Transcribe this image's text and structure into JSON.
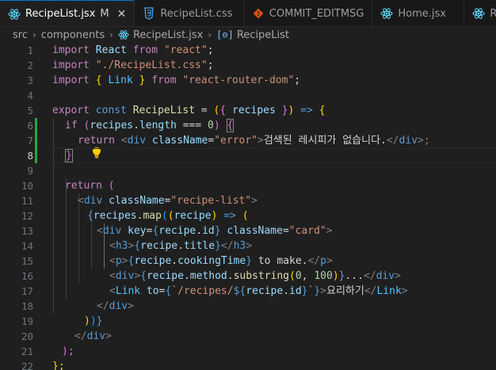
{
  "tabs": [
    {
      "label": "RecipeList.jsx",
      "modified": "M",
      "icon": "react-icon",
      "active": true
    },
    {
      "label": "RecipeList.css",
      "icon": "css-icon",
      "active": false
    },
    {
      "label": "COMMIT_EDITMSG",
      "icon": "git-icon",
      "active": false
    },
    {
      "label": "Home.jsx",
      "icon": "react-icon",
      "active": false
    },
    {
      "label": "Re",
      "icon": "react-icon",
      "active": false
    }
  ],
  "breadcrumb": {
    "parts": [
      "src",
      "components",
      "RecipeList.jsx",
      "RecipeList"
    ]
  },
  "line_numbers": [
    "1",
    "2",
    "3",
    "4",
    "5",
    "6",
    "7",
    "8",
    "9",
    "10",
    "11",
    "12",
    "13",
    "14",
    "15",
    "16",
    "17",
    "18",
    "19",
    "20",
    "21",
    "22"
  ],
  "code": {
    "l1": [
      "import",
      " React ",
      "from",
      " \"react\"",
      ";"
    ],
    "l2": [
      "import",
      " \"./RecipeList.css\"",
      ";"
    ],
    "l3": [
      "import",
      " { ",
      "Link",
      " } ",
      "from",
      " \"react-router-dom\"",
      ";"
    ],
    "l5": [
      "export",
      " const ",
      "RecipeList",
      " = ",
      "(",
      "{ ",
      "recipes",
      " }",
      ")",
      " => ",
      "{"
    ],
    "l6": [
      "if",
      " (",
      "recipes",
      ".",
      "length",
      " === ",
      "0",
      ") ",
      "{"
    ],
    "l7": [
      "return",
      " <",
      "div",
      " className",
      "=",
      "\"error\"",
      ">",
      "검색된 레시피가 없습니다.",
      "</",
      "div",
      ">;"
    ],
    "l8": [
      "}"
    ],
    "l10": [
      "return",
      " ("
    ],
    "l11": [
      "<",
      "div",
      " className",
      "=",
      "\"recipe-list\"",
      ">"
    ],
    "l12": [
      "{",
      "recipes",
      ".",
      "map",
      "(",
      "(",
      "recipe",
      ")",
      " => ",
      "("
    ],
    "l13": [
      "<",
      "div",
      " key",
      "=",
      "{",
      "recipe",
      ".",
      "id",
      "}",
      " className",
      "=",
      "\"card\"",
      ">"
    ],
    "l14": [
      "<",
      "h3",
      ">",
      "{",
      "recipe",
      ".",
      "title",
      "}",
      "</",
      "h3",
      ">"
    ],
    "l15": [
      "<",
      "p",
      ">",
      "{",
      "recipe",
      ".",
      "cookingTime",
      "}",
      " to make.",
      "</",
      "p",
      ">"
    ],
    "l16": [
      "<",
      "div",
      ">",
      "{",
      "recipe",
      ".",
      "method",
      ".",
      "substring",
      "(",
      "0",
      ", ",
      "100",
      ")",
      "}",
      "...",
      "</",
      "div",
      ">"
    ],
    "l17": [
      "<",
      "Link",
      " to",
      "=",
      "{",
      "`/recipes/",
      "${",
      "recipe",
      ".",
      "id",
      "}",
      "`",
      "}",
      ">",
      "요리하기",
      "</",
      "Link",
      ">"
    ],
    "l18": [
      "</",
      "div",
      ">"
    ],
    "l19": [
      ")",
      ")",
      "}"
    ],
    "l20": [
      "</",
      "div",
      ">"
    ],
    "l21": [
      ");"
    ],
    "l22": [
      "};"
    ]
  },
  "colors": {
    "background": "#1f1f1f",
    "tabbar": "#181818",
    "accent": "#0078d4",
    "git_added": "#2ea043"
  }
}
